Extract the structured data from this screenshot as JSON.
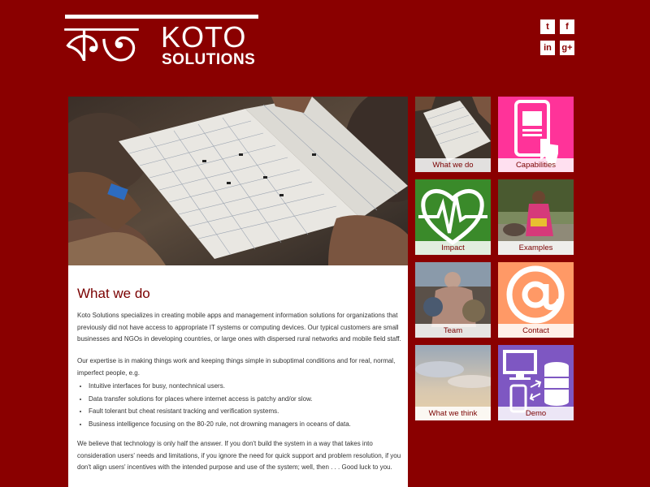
{
  "brand": {
    "glyph": "কত",
    "name": "KOTO",
    "tagline": "SOLUTIONS",
    "background": "#8a0000"
  },
  "social": [
    {
      "icon": "twitter-icon",
      "glyph": "t"
    },
    {
      "icon": "facebook-icon",
      "glyph": "f"
    },
    {
      "icon": "linkedin-icon",
      "glyph": "in"
    },
    {
      "icon": "google-plus-icon",
      "glyph": "g+"
    }
  ],
  "main": {
    "heading": "What we do",
    "intro": "Koto Solutions specializes in creating mobile apps and management information solutions for organizations that previously did not have access to appropriate IT systems or computing devices. Our typical customers are small businesses and NGOs in developing countries, or large ones with dispersed rural networks and mobile field staff.",
    "expertise": "Our expertise is in making things work and keeping things simple in suboptimal conditions and for real, normal, imperfect people, e.g.",
    "bullets": [
      "Intuitive interfaces for busy, nontechnical users.",
      "Data transfer solutions for places where internet access is patchy and/or slow.",
      "Fault tolerant but cheat resistant tracking and verification systems.",
      "Business intelligence focusing on the 80-20 rule, not drowning managers in oceans of data."
    ],
    "closing": "We believe that technology is only half the answer. If you don't build the system in a way that takes into consideration users' needs and limitations, if you ignore the need for quick support and problem resolution, if you don't align users' incentives with the intended purpose and use of the system; well, then . . . Good luck to you."
  },
  "tiles": {
    "what_we_do": "What we do",
    "capabilities": "Capabilities",
    "impact": "Impact",
    "examples": "Examples",
    "team": "Team",
    "contact": "Contact",
    "what_we_think": "What we think",
    "demo": "Demo",
    "colors": {
      "capabilities": "#ff3399",
      "impact": "#3a8a2a",
      "contact": "#ff9966",
      "demo": "#7e57c2"
    }
  }
}
